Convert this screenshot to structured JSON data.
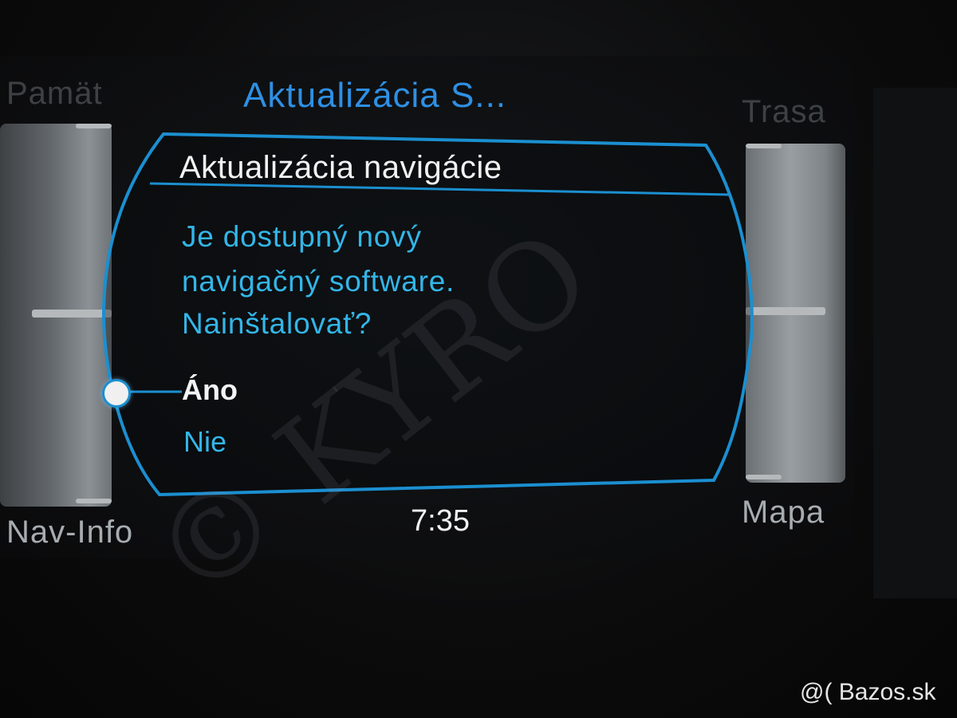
{
  "page_title": "Aktualizácia S...",
  "soft_keys": {
    "top_left": "Pamät",
    "top_right": "Trasa",
    "bottom_left": "Nav-Info",
    "bottom_right": "Mapa"
  },
  "dialog": {
    "title": "Aktualizácia navigácie",
    "message_lines": [
      "Je dostupný nový",
      "navigačný software.",
      "Nainštalovať?"
    ],
    "options": [
      {
        "label": "Áno",
        "selected": true
      },
      {
        "label": "Nie",
        "selected": false
      }
    ]
  },
  "clock": "7:35",
  "watermark": "© KYRO",
  "site_mark": "@( Bazos.sk",
  "colors": {
    "accent_blue": "#2f8fe3",
    "text_cyan": "#33b6e8",
    "frame_blue": "#1b8fd0"
  }
}
